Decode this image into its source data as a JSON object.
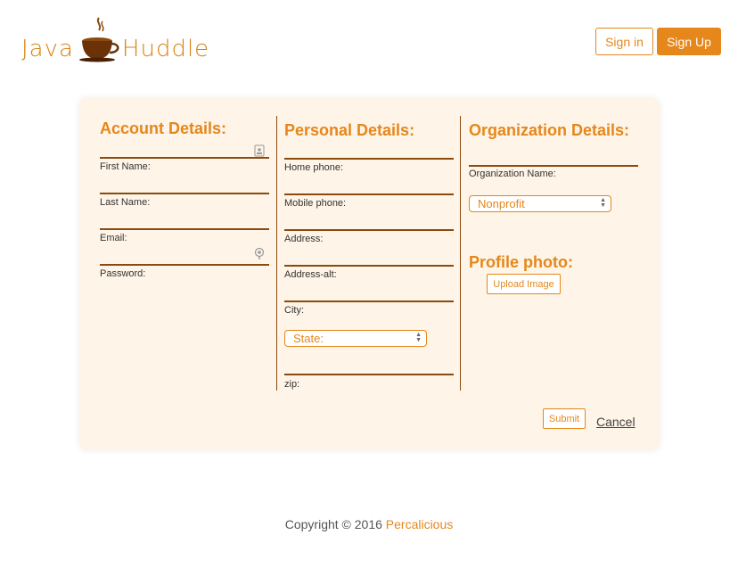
{
  "header": {
    "logo_left": "Java",
    "logo_right": "Huddle",
    "signin_label": "Sign in",
    "signup_label": "Sign Up"
  },
  "account": {
    "title": "Account Details:",
    "first_name_label": "First Name:",
    "last_name_label": "Last Name:",
    "email_label": "Email:",
    "password_label": "Password:"
  },
  "personal": {
    "title": "Personal Details:",
    "home_phone_label": "Home phone:",
    "mobile_phone_label": "Mobile phone:",
    "address_label": "Address:",
    "address_alt_label": "Address-alt:",
    "city_label": "City:",
    "state_selected": "State:",
    "zip_label": "zip:"
  },
  "organization": {
    "title": "Organization Details:",
    "org_name_label": "Organization Name:",
    "org_type_selected": "Nonprofit"
  },
  "profile": {
    "title": "Profile photo:",
    "upload_label": "Upload Image"
  },
  "actions": {
    "submit_label": "Submit",
    "cancel_label": "Cancel"
  },
  "footer": {
    "copyright": "Copyright © 2016",
    "brand": "Percalicious"
  },
  "colors": {
    "accent": "#e5871b",
    "card_bg": "#fef4e7",
    "line": "#8a4a10"
  },
  "icons": {
    "contact_card": "contact-card-icon",
    "key": "key-icon",
    "coffee_cup": "coffee-cup-icon"
  }
}
